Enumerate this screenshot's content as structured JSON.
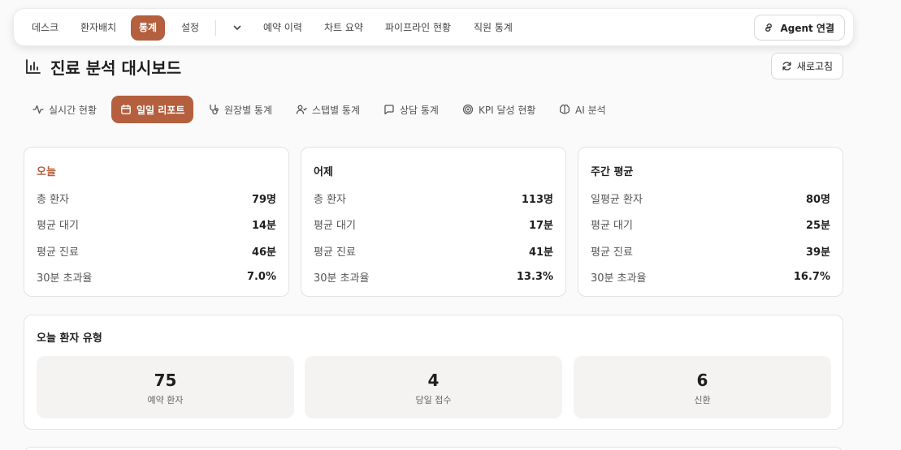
{
  "nav": {
    "items": [
      "데스크",
      "환자배치",
      "통계",
      "설정",
      "예약 이력",
      "차트 요약",
      "파이프라인 현황",
      "직원 통계"
    ],
    "active": "통계",
    "more_icon": "chevron-down-icon",
    "agent_button": "Agent 연결",
    "agent_icon": "link-icon"
  },
  "page": {
    "title": "진료 분석 대시보드",
    "title_icon": "bar-chart-icon",
    "refresh_label": "새로고침",
    "refresh_icon": "refresh-icon"
  },
  "tabs": [
    {
      "label": "실시간 현황",
      "icon": "activity-icon"
    },
    {
      "label": "일일 리포트",
      "icon": "calendar-icon",
      "active": true
    },
    {
      "label": "원장별 통계",
      "icon": "stethoscope-icon"
    },
    {
      "label": "스탭별 통계",
      "icon": "users-icon"
    },
    {
      "label": "상담 통계",
      "icon": "message-square-icon"
    },
    {
      "label": "KPI 달성 현황",
      "icon": "target-icon"
    },
    {
      "label": "AI 분석",
      "icon": "brain-icon"
    }
  ],
  "cards": [
    {
      "title": "오늘",
      "rows": [
        {
          "label": "총 환자",
          "value": "79명"
        },
        {
          "label": "평균 대기",
          "value": "14분"
        },
        {
          "label": "평균 진료",
          "value": "46분"
        },
        {
          "label": "30분 초과율",
          "value": "7.0%"
        }
      ]
    },
    {
      "title": "어제",
      "rows": [
        {
          "label": "총 환자",
          "value": "113명"
        },
        {
          "label": "평균 대기",
          "value": "17분"
        },
        {
          "label": "평균 진료",
          "value": "41분"
        },
        {
          "label": "30분 초과율",
          "value": "13.3%"
        }
      ]
    },
    {
      "title": "주간 평균",
      "rows": [
        {
          "label": "일평균 환자",
          "value": "80명"
        },
        {
          "label": "평균 대기",
          "value": "25분"
        },
        {
          "label": "평균 진료",
          "value": "39분"
        },
        {
          "label": "30분 초과율",
          "value": "16.7%"
        }
      ]
    }
  ],
  "patient_types": {
    "title": "오늘 환자 유형",
    "items": [
      {
        "value": "75",
        "label": "예약 환자"
      },
      {
        "value": "4",
        "label": "당일 접수"
      },
      {
        "value": "6",
        "label": "신환"
      }
    ]
  },
  "colors": {
    "accent": "#b45f3d",
    "background": "#fafafa",
    "card_border": "#e3e3e3",
    "stat_box": "#f4f3f2"
  }
}
